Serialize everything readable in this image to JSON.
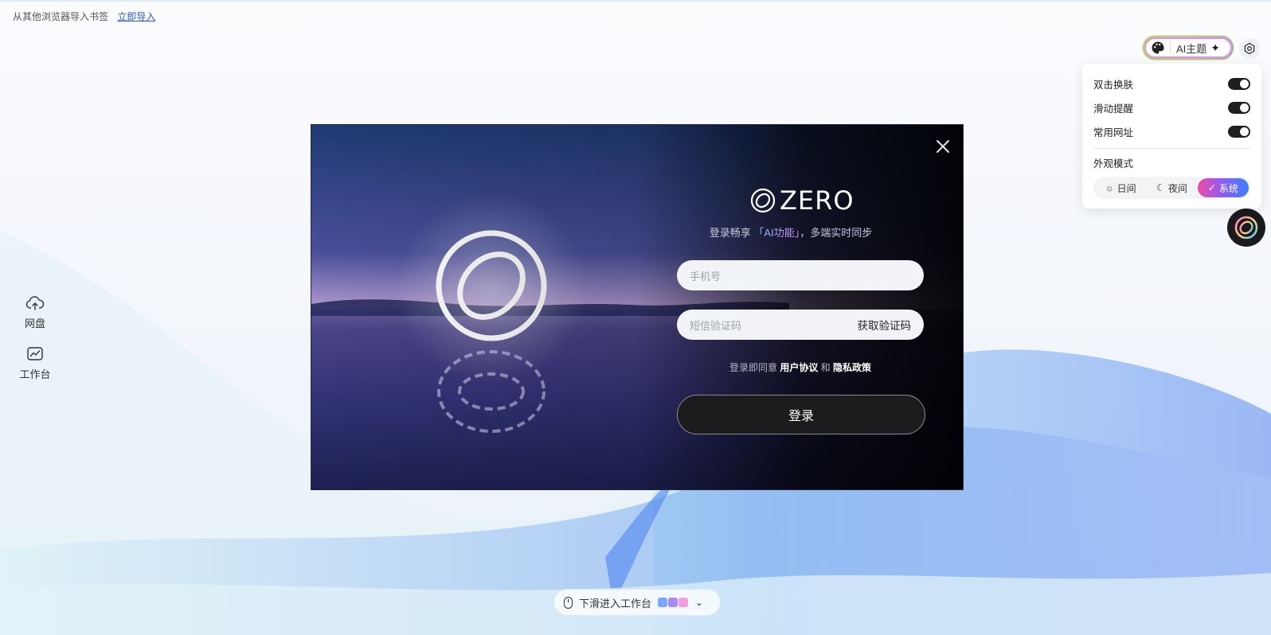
{
  "import_bar": {
    "text": "从其他浏览器导入书签",
    "link": "立即导入"
  },
  "top_right": {
    "ai_theme_label": "AI主题",
    "sparkle": "✦"
  },
  "settings_panel": {
    "toggles": [
      {
        "label": "双击换肤",
        "on": true
      },
      {
        "label": "滑动提醒",
        "on": true
      },
      {
        "label": "常用网址",
        "on": true
      }
    ],
    "appearance_title": "外观模式",
    "modes": [
      {
        "icon": "☼",
        "label": "日间",
        "active": false
      },
      {
        "icon": "☾",
        "label": "夜间",
        "active": false
      },
      {
        "icon": "✓",
        "label": "系统",
        "active": true
      }
    ]
  },
  "sidebar": {
    "items": [
      {
        "label": "网盘",
        "icon": "cloud-upload-icon"
      },
      {
        "label": "工作台",
        "icon": "chart-icon"
      }
    ]
  },
  "login": {
    "brand": "ZERO",
    "subtitle_prefix": "登录畅享",
    "subtitle_ai": "「AI功能」",
    "subtitle_suffix": "，多端实时同步",
    "phone_placeholder": "手机号",
    "code_placeholder": "短信验证码",
    "get_code": "获取验证码",
    "agree_prefix": "登录即同意",
    "user_agreement": "用户协议",
    "and": "和",
    "privacy_policy": "隐私政策",
    "login_button": "登录"
  },
  "bottom": {
    "scroll_hint": "下滑进入工作台",
    "chevron": "⌄"
  },
  "colors": {
    "accent_gradient_start": "#f04aa8",
    "accent_gradient_end": "#3b82f6",
    "dark": "#1c1c1e",
    "link": "#2a57c9"
  }
}
